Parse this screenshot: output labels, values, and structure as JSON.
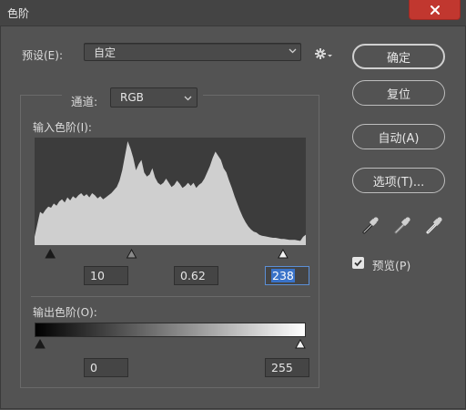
{
  "window": {
    "title": "色阶"
  },
  "preset": {
    "label": "预设(E):",
    "value": "自定"
  },
  "buttons": {
    "ok": "确定",
    "reset": "复位",
    "auto": "自动(A)",
    "options": "选项(T)..."
  },
  "channel": {
    "label": "通道:",
    "value": "RGB"
  },
  "input_levels": {
    "label": "输入色阶(I):",
    "shadow": "10",
    "midtone": "0.62",
    "highlight": "238",
    "histogram": [
      0.08,
      0.2,
      0.32,
      0.3,
      0.34,
      0.37,
      0.36,
      0.4,
      0.38,
      0.42,
      0.44,
      0.41,
      0.46,
      0.43,
      0.47,
      0.45,
      0.48,
      0.5,
      0.47,
      0.49,
      0.46,
      0.5,
      0.48,
      0.45,
      0.47,
      0.44,
      0.46,
      0.48,
      0.5,
      0.53,
      0.56,
      0.62,
      0.72,
      0.86,
      1.0,
      0.93,
      0.84,
      0.72,
      0.78,
      0.82,
      0.7,
      0.66,
      0.68,
      0.74,
      0.65,
      0.6,
      0.58,
      0.6,
      0.64,
      0.6,
      0.56,
      0.58,
      0.62,
      0.59,
      0.55,
      0.57,
      0.6,
      0.57,
      0.6,
      0.55,
      0.58,
      0.6,
      0.64,
      0.7,
      0.76,
      0.84,
      0.9,
      0.86,
      0.82,
      0.74,
      0.7,
      0.62,
      0.55,
      0.47,
      0.4,
      0.33,
      0.27,
      0.22,
      0.18,
      0.15,
      0.13,
      0.12,
      0.1,
      0.09,
      0.085,
      0.08,
      0.075,
      0.07,
      0.07,
      0.065,
      0.06,
      0.06,
      0.055,
      0.05,
      0.05,
      0.05,
      0.045,
      0.04,
      0.08,
      0.1
    ],
    "points": [
      10,
      0.62,
      238
    ]
  },
  "output_levels": {
    "label": "输出色阶(O):",
    "min": "0",
    "max": "255",
    "points": [
      0,
      255
    ]
  },
  "preview": {
    "label": "预览(P)",
    "checked": true
  },
  "icons": {
    "close": "close-icon",
    "gear": "gear-icon",
    "chevron": "chevron-down-icon",
    "eyedropper_black": "black-eyedropper-icon",
    "eyedropper_gray": "gray-eyedropper-icon",
    "eyedropper_white": "white-eyedropper-icon",
    "check": "check-icon"
  },
  "colors": {
    "panel": "#535353",
    "titlebar": "#444444",
    "close_red": "#c1372f",
    "histogram_fill": "#cfcfcf",
    "histogram_bg": "#3c3c3c",
    "selection_blue": "#3a73c9"
  }
}
